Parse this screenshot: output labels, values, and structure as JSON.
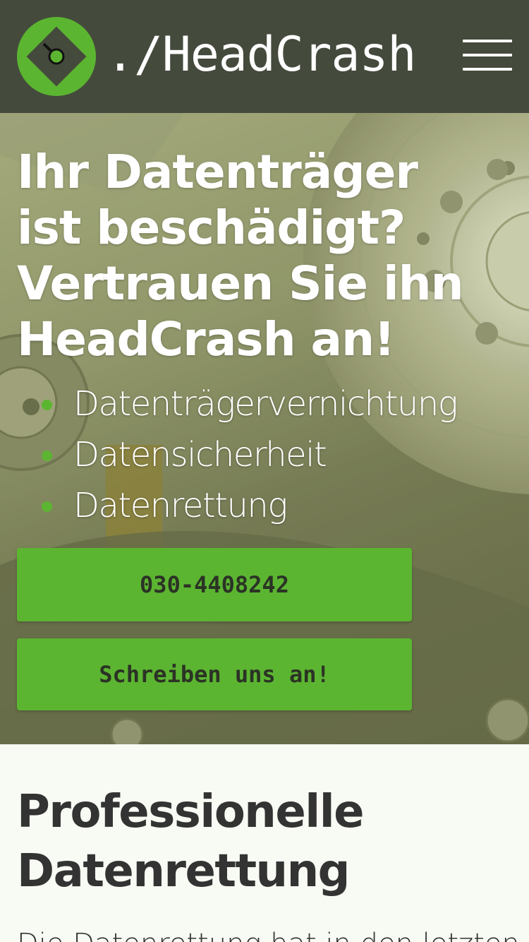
{
  "header": {
    "logo_icon": "hard-drive-icon",
    "brand": "./HeadCrash",
    "menu_icon": "hamburger-menu-icon"
  },
  "hero": {
    "title": "Ihr Datenträger ist beschädigt? Vertrauen Sie ihn HeadCrash an!",
    "services": [
      {
        "label": "Datenträgervernichtung"
      },
      {
        "label": "Datensicherheit"
      },
      {
        "label": "Datenrettung"
      }
    ],
    "phone_button": "030-4408242",
    "contact_button": "Schreiben uns an!",
    "background_image": "hard-drive-platter-photo"
  },
  "content": {
    "section_title": "Professionelle Datenrettung",
    "intro_text": "Die Datenrettung hat in den letzten Jahren"
  },
  "colors": {
    "header_bg": "#444a3c",
    "accent_green": "#5cb531",
    "page_bg": "#f8fbf4",
    "text_dark": "#333333"
  }
}
